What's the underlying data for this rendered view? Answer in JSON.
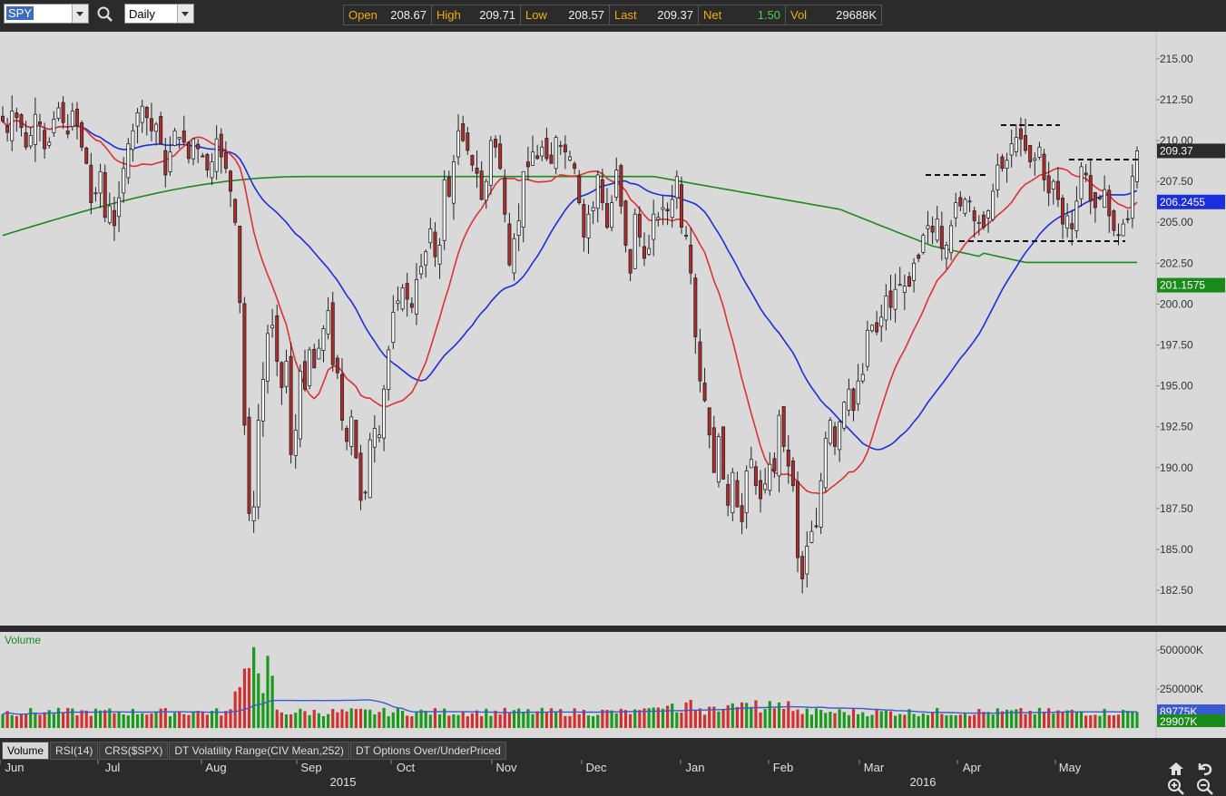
{
  "toolbar": {
    "symbol": "SPY",
    "interval": "Daily",
    "quote": [
      {
        "label": "Open",
        "value": "208.67"
      },
      {
        "label": "High",
        "value": "209.71"
      },
      {
        "label": "Low",
        "value": "208.57"
      },
      {
        "label": "Last",
        "value": "209.37"
      },
      {
        "label": "Net",
        "value": "1.50"
      },
      {
        "label": "Vol",
        "value": "29688K"
      }
    ]
  },
  "tabs": [
    "Volume",
    "RSI(14)",
    "CRS($SPX)",
    "DT Volatility Range(CIV Mean,252)",
    "DT Options Over/UnderPriced"
  ],
  "colors": {
    "up": "#ffffff",
    "down": "#b52a2a",
    "ma20": "#e03030",
    "ma50": "#1a2ee0",
    "ma200": "#1a8a1a",
    "volume_up": "#1a9a1a",
    "volume_down": "#d23030"
  },
  "chart_data": [
    {
      "type": "candlestick",
      "title": "SPY Daily",
      "ylim": [
        180.4,
        216.6
      ],
      "yticks": [
        "215.00",
        "212.50",
        "210.00",
        "207.50",
        "205.00",
        "202.50",
        "200.00",
        "197.50",
        "195.00",
        "192.50",
        "190.00",
        "187.50",
        "185.00",
        "182.50"
      ],
      "x_months": [
        "Jun",
        "Jul",
        "Aug",
        "Sep",
        "Oct",
        "Nov",
        "Dec",
        "Jan",
        "Feb",
        "Mar",
        "Apr",
        "May"
      ],
      "x_years": [
        "2015",
        "2016"
      ],
      "price_labels": [
        {
          "label": "Last",
          "value": "209.37"
        },
        {
          "label": "MA50",
          "value": "206.2455"
        },
        {
          "label": "MA200",
          "value": "201.1575"
        }
      ],
      "closes": [
        211.2,
        210.5,
        211.8,
        211.4,
        210.8,
        209.6,
        210.3,
        211.6,
        211.0,
        209.5,
        209.9,
        211.3,
        212.0,
        211.1,
        210.4,
        211.8,
        210.9,
        209.6,
        208.6,
        206.2,
        206.8,
        208.1,
        205.3,
        206.0,
        204.8,
        206.5,
        208.3,
        209.8,
        210.6,
        211.7,
        212.1,
        211.4,
        210.6,
        211.0,
        209.8,
        207.9,
        209.3,
        210.6,
        210.2,
        209.9,
        208.9,
        210.1,
        209.5,
        209.0,
        208.2,
        208.7,
        210.1,
        209.0,
        208.3,
        206.9,
        205.0,
        200.1,
        192.6,
        187.2,
        187.6,
        192.9,
        195.4,
        198.2,
        198.7,
        196.5,
        194.9,
        196.5,
        190.8,
        192.3,
        195.9,
        194.8,
        197.2,
        196.1,
        197.3,
        198.5,
        199.6,
        196.3,
        195.8,
        192.9,
        191.6,
        193.1,
        190.6,
        188.0,
        188.5,
        191.7,
        192.4,
        192.0,
        194.8,
        197.2,
        199.5,
        200.2,
        201.0,
        200.3,
        199.8,
        201.5,
        202.3,
        203.2,
        204.6,
        202.9,
        203.6,
        207.6,
        206.6,
        208.7,
        210.6,
        210.0,
        209.4,
        208.5,
        208.0,
        206.4,
        207.5,
        210.0,
        209.6,
        208.3,
        205.5,
        202.4,
        204.0,
        205.1,
        208.1,
        208.4,
        209.3,
        208.9,
        209.6,
        208.9,
        208.6,
        210.2,
        209.7,
        209.3,
        209.0,
        208.3,
        206.2,
        204.1,
        205.5,
        205.9,
        207.9,
        206.2,
        204.7,
        206.2,
        208.2,
        206.0,
        203.6,
        201.9,
        205.5,
        204.1,
        202.8,
        203.4,
        205.5,
        205.3,
        205.9,
        205.7,
        206.4,
        207.8,
        204.7,
        204.2,
        201.9,
        198.0,
        195.3,
        194.1,
        192.0,
        189.7,
        191.9,
        189.3,
        187.7,
        189.7,
        187.6,
        186.7,
        189.8,
        190.5,
        188.9,
        188.1,
        189.0,
        190.2,
        189.8,
        193.2,
        191.3,
        190.1,
        188.9,
        184.5,
        183.2,
        185.2,
        186.1,
        186.4,
        189.2,
        191.8,
        192.9,
        191.3,
        192.8,
        194.0,
        194.8,
        193.5,
        195.3,
        195.7,
        198.4,
        198.7,
        198.3,
        199.2,
        200.5,
        199.8,
        200.9,
        201.2,
        201.1,
        201.1,
        202.5,
        202.8,
        204.2,
        204.8,
        204.4,
        205.2,
        203.4,
        203.6,
        204.8,
        206.2,
        206.0,
        206.4,
        206.3,
        205.1,
        205.0,
        204.7,
        205.7,
        206.9,
        208.5,
        208.3,
        208.8,
        209.8,
        210.2,
        210.1,
        209.4,
        208.7,
        208.9,
        209.6,
        207.6,
        206.8,
        207.5,
        206.4,
        204.9,
        205.4,
        204.6,
        206.3,
        208.4,
        207.9,
        206.3,
        205.9,
        206.5,
        207.0,
        205.4,
        204.5,
        204.2,
        204.9,
        205.2,
        207.8,
        209.37
      ]
    },
    {
      "type": "bar",
      "title": "Volume",
      "ylabel": "Volume",
      "ylim": [
        0,
        600000
      ],
      "yticks": [
        "500000K",
        "250000K"
      ],
      "value_labels": [
        {
          "label": "Volume MA",
          "value": "89775K"
        },
        {
          "label": "Volume",
          "value": "29907K"
        }
      ]
    }
  ]
}
